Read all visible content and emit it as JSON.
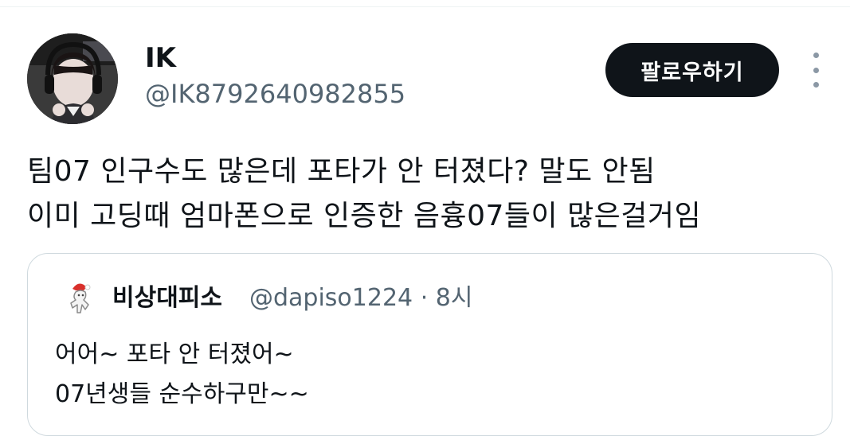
{
  "author": {
    "display_name": "IK",
    "handle": "@IK8792640982855"
  },
  "follow_label": "팔로우하기",
  "more_icon": "more-vertical-icon",
  "tweet": {
    "lines": [
      "팀07 인구수도 많은데 포타가 안 터졌다? 말도 안됨",
      "이미 고딩때 엄마폰으로 인증한 음흉07들이 많은걸거임"
    ]
  },
  "quote": {
    "display_name": "비상대피소",
    "handle": "@dapiso1224",
    "separator": "·",
    "time": "8시",
    "lines": [
      "어어~ 포타 안 터졌어~",
      "07년생들 순수하구만~~"
    ]
  }
}
